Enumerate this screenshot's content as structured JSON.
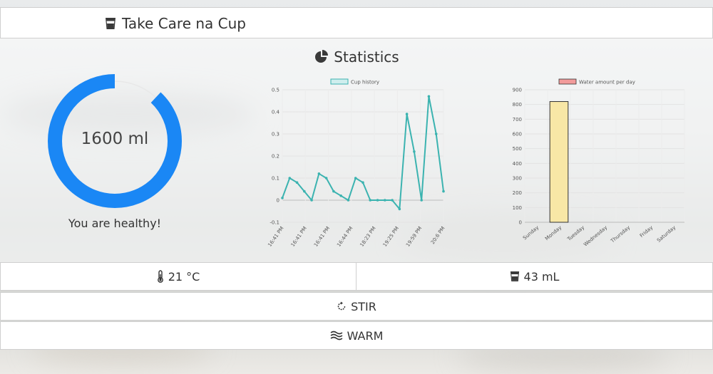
{
  "header": {
    "icon": "cup-icon",
    "title": "Take Care na Cup"
  },
  "statistics": {
    "icon": "pie-chart-icon",
    "heading": "Statistics",
    "ring": {
      "value_label": "1600 ml",
      "progress_fraction": 0.88,
      "color": "#1a87f5",
      "track_color": "#e8e8e8"
    },
    "health_text": "You are healthy!"
  },
  "chart_data": [
    {
      "type": "line",
      "title": "",
      "series": [
        {
          "name": "Cup history",
          "color": "#3bb3b0",
          "values": [
            0.01,
            0.1,
            0.08,
            0.04,
            0.0,
            0.12,
            0.1,
            0.04,
            0.02,
            0.0,
            0.1,
            0.08,
            0.0,
            0.0,
            0.0,
            0.0,
            -0.04,
            0.39,
            0.22,
            0.0,
            0.47,
            0.3,
            0.04
          ]
        }
      ],
      "x_tick_labels": [
        "16:41 PM",
        "16:41 PM",
        "16:41 PM",
        "16:44 PM",
        "18:23 PM",
        "19:25 PM",
        "19:59 PM",
        "20:6 PM"
      ],
      "y_ticks": [
        "0.5",
        "0.4",
        "0.3",
        "0.2",
        "0.1",
        "0",
        "-0.1"
      ],
      "ylim": [
        -0.1,
        0.5
      ],
      "grid": true,
      "legend": "top"
    },
    {
      "type": "bar",
      "title": "",
      "categories": [
        "Sunday",
        "Monday",
        "Tuesday",
        "Wednesday",
        "Thursday",
        "Friday",
        "Saturday"
      ],
      "series": [
        {
          "name": "Water amount per day",
          "fill": "#f8e7a6",
          "stroke": "#333333",
          "values": [
            0,
            820,
            0,
            0,
            0,
            0,
            0
          ]
        }
      ],
      "legend_color": "#f29b9b",
      "y_ticks": [
        "900",
        "800",
        "700",
        "600",
        "500",
        "400",
        "300",
        "200",
        "100",
        "0"
      ],
      "ylim": [
        0,
        900
      ],
      "grid": true,
      "legend": "top"
    }
  ],
  "sensors": {
    "temperature": {
      "icon": "thermometer-icon",
      "label": "21 °C"
    },
    "volume": {
      "icon": "cup-icon",
      "label": "43 mL"
    }
  },
  "actions": {
    "stir": {
      "icon": "rotate-icon",
      "label": "STIR"
    },
    "warm": {
      "icon": "waves-icon",
      "label": "WARM"
    }
  }
}
